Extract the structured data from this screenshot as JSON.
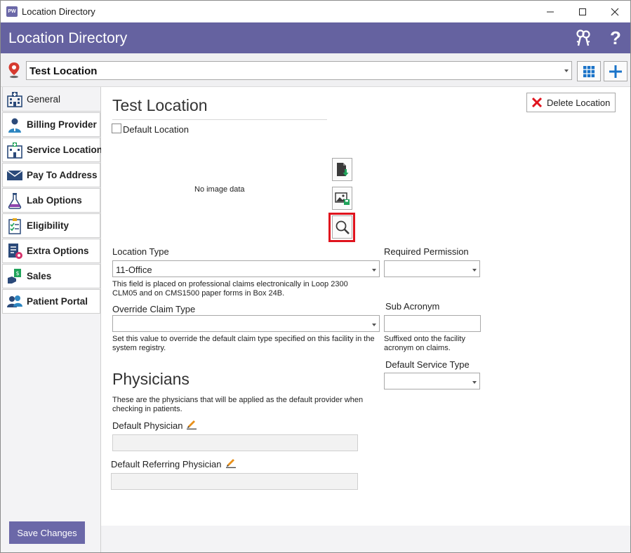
{
  "window": {
    "title": "Location Directory",
    "app_icon_text": "PW",
    "buttons": [
      "minimize",
      "maximize",
      "close"
    ]
  },
  "header": {
    "title": "Location Directory",
    "icons": [
      "keys-icon",
      "help-icon"
    ]
  },
  "location_selector": {
    "value": "Test Location"
  },
  "sidebar": {
    "items": [
      {
        "label": "General",
        "icon": "hospital-icon"
      },
      {
        "label": "Billing Provider",
        "icon": "doctor-icon"
      },
      {
        "label": "Service Location",
        "icon": "clinic-icon"
      },
      {
        "label": "Pay To Address",
        "icon": "envelope-icon"
      },
      {
        "label": "Lab Options",
        "icon": "flask-icon"
      },
      {
        "label": "Eligibility",
        "icon": "checklist-icon"
      },
      {
        "label": "Extra Options",
        "icon": "document-gear-icon"
      },
      {
        "label": "Sales",
        "icon": "money-hand-icon"
      },
      {
        "label": "Patient Portal",
        "icon": "users-icon"
      }
    ],
    "save_label": "Save Changes"
  },
  "main": {
    "title": "Test Location",
    "delete_label": "Delete Location",
    "default_location_label": "Default Location",
    "no_image_text": "No image data",
    "location_type": {
      "label": "Location Type",
      "value": "11-Office",
      "help": "This field is placed on professional claims electronically in Loop 2300 CLM05 and on CMS1500 paper forms in Box 24B."
    },
    "required_permission": {
      "label": "Required Permission",
      "value": ""
    },
    "override_claim_type": {
      "label": "Override Claim Type",
      "value": "",
      "help": "Set this value to override the default claim type specified on this facility in the system registry."
    },
    "sub_acronym": {
      "label": "Sub Acronym",
      "value": "",
      "help": "Suffixed onto the facility acronym on claims."
    },
    "default_service_type": {
      "label": "Default Service Type",
      "value": ""
    },
    "physicians": {
      "title": "Physicians",
      "help": "These are the physicians that will be applied as the default provider when checking in patients.",
      "default_physician_label": "Default Physician",
      "default_physician_value": "",
      "default_referring_label": "Default Referring Physician",
      "default_referring_value": ""
    }
  },
  "colors": {
    "header": "#6562a0",
    "save_button": "#6b68a8",
    "highlight": "#e0141e",
    "accent_blue": "#1a73c8"
  }
}
